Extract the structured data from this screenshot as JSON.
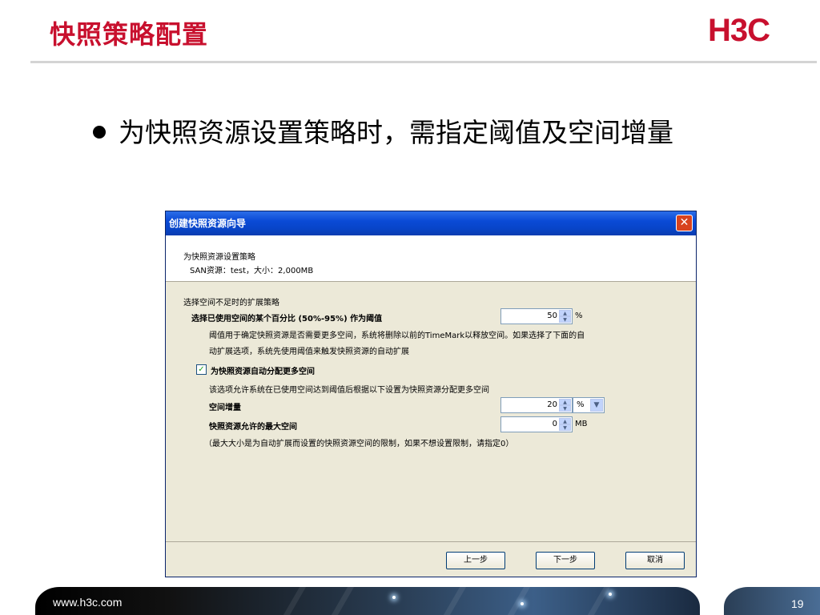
{
  "slide": {
    "title": "快照策略配置",
    "logo": "H3C",
    "bullet": "为快照资源设置策略时，需指定阈值及空间增量",
    "footer_url": "www.h3c.com",
    "page_number": "19"
  },
  "dialog": {
    "title": "创建快照资源向导",
    "close_glyph": "✕",
    "header": {
      "title": "为快照资源设置策略",
      "subtitle": "SAN资源：test，大小：2,000MB"
    },
    "section_label": "选择空间不足时的扩展策略",
    "threshold": {
      "label": "选择已使用空间的某个百分比 (50%-95%) 作为阈值",
      "value": "50",
      "unit": "%",
      "description_line1": "阈值用于确定快照资源是否需要更多空间，系统将删除以前的TimeMark以释放空间。如果选择了下面的自",
      "description_line2": "动扩展选项，系统先使用阈值来触发快照资源的自动扩展"
    },
    "auto_expand": {
      "checked": true,
      "check_glyph": "✓",
      "label": "为快照资源自动分配更多空间",
      "description": "该选项允许系统在已使用空间达到阈值后根据以下设置为快照资源分配更多空间"
    },
    "increment": {
      "label": "空间增量",
      "value": "20",
      "unit_selected": "%"
    },
    "max_space": {
      "label": "快照资源允许的最大空间",
      "value": "0",
      "unit": "MB",
      "note": "（最大大小是为自动扩展而设置的快照资源空间的限制，如果不想设置限制，请指定0）"
    },
    "buttons": {
      "prev": "上一步",
      "next": "下一步",
      "cancel": "取消"
    }
  },
  "colors": {
    "accent_red": "#c8102e",
    "titlebar_blue": "#0a4ad6",
    "dialog_bg": "#ece9d8"
  }
}
